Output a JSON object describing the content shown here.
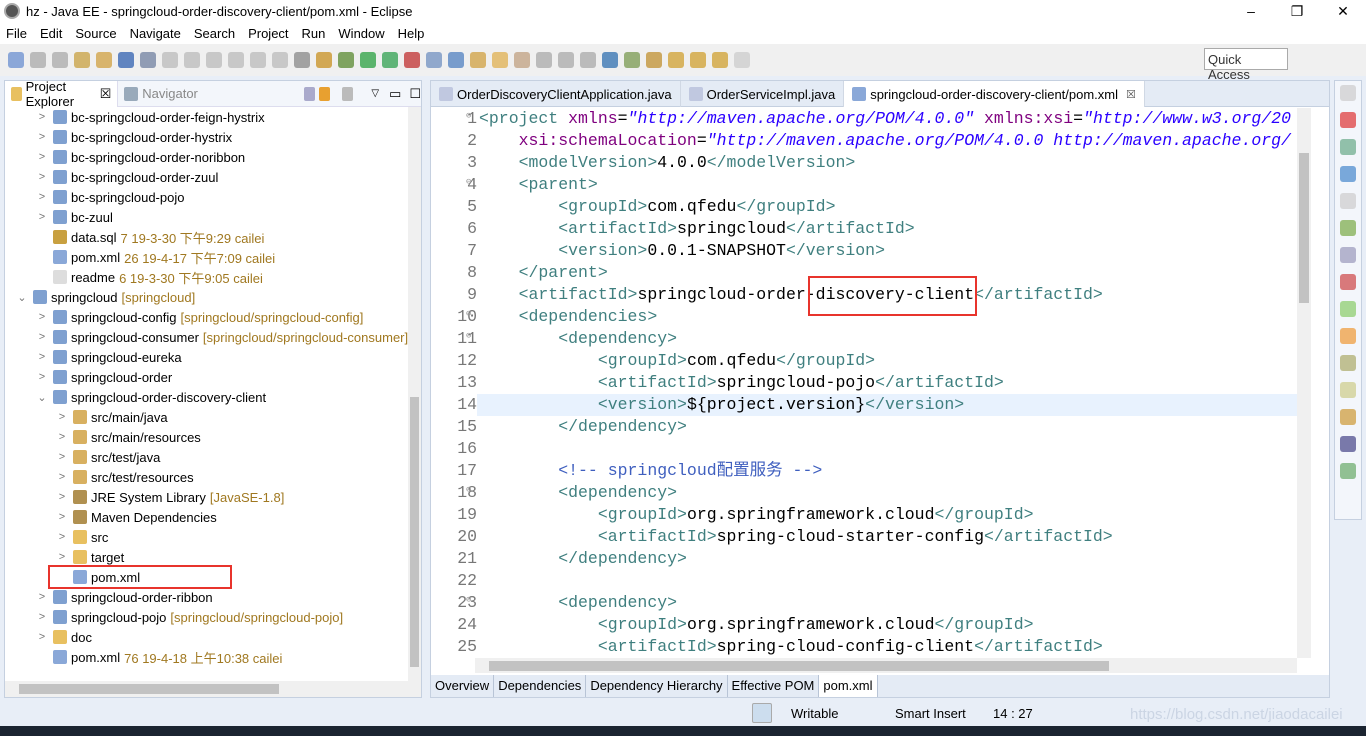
{
  "window": {
    "title": "hz - Java EE - springcloud-order-discovery-client/pom.xml - Eclipse",
    "controls": [
      "–",
      "❐",
      "✕"
    ]
  },
  "menu": [
    "File",
    "Edit",
    "Source",
    "Navigate",
    "Search",
    "Project",
    "Run",
    "Window",
    "Help"
  ],
  "quick_access": "Quick Access",
  "explorer": {
    "tabs": [
      {
        "label": "Project Explorer",
        "icon": "folder-icon",
        "close": "☒"
      },
      {
        "label": "Navigator",
        "icon": "navigator-icon"
      }
    ],
    "rows": [
      {
        "indent": 2,
        "tw": ">",
        "label": "bc-springcloud-order-feign-hystrix",
        "icon": "maven-project-icon"
      },
      {
        "indent": 2,
        "tw": ">",
        "label": "bc-springcloud-order-hystrix",
        "icon": "maven-project-icon"
      },
      {
        "indent": 2,
        "tw": ">",
        "label": "bc-springcloud-order-noribbon",
        "icon": "maven-project-icon"
      },
      {
        "indent": 2,
        "tw": ">",
        "label": "bc-springcloud-order-zuul",
        "icon": "maven-project-icon"
      },
      {
        "indent": 2,
        "tw": ">",
        "label": "bc-springcloud-pojo",
        "icon": "maven-project-icon"
      },
      {
        "indent": 2,
        "tw": ">",
        "label": "bc-zuul",
        "icon": "maven-project-icon"
      },
      {
        "indent": 2,
        "tw": "",
        "label": "data.sql",
        "dec": "7  19-3-30 下午9:29  cailei",
        "icon": "sql-file-icon"
      },
      {
        "indent": 2,
        "tw": "",
        "label": "pom.xml",
        "dec": "26  19-4-17 下午7:09  cailei",
        "icon": "xml-file-icon"
      },
      {
        "indent": 2,
        "tw": "",
        "label": "readme",
        "dec": "6  19-3-30 下午9:05  cailei",
        "icon": "text-file-icon"
      },
      {
        "indent": 1,
        "tw": "⌄",
        "label": "springcloud",
        "dec": "[springcloud]",
        "icon": "maven-project-icon"
      },
      {
        "indent": 2,
        "tw": ">",
        "label": "springcloud-config",
        "dec": "[springcloud/springcloud-config]",
        "icon": "maven-project-icon"
      },
      {
        "indent": 2,
        "tw": ">",
        "label": "springcloud-consumer",
        "dec": "[springcloud/springcloud-consumer]",
        "icon": "maven-project-icon"
      },
      {
        "indent": 2,
        "tw": ">",
        "label": "springcloud-eureka",
        "icon": "maven-project-icon"
      },
      {
        "indent": 2,
        "tw": ">",
        "label": "springcloud-order",
        "icon": "maven-project-icon"
      },
      {
        "indent": 2,
        "tw": "⌄",
        "label": "springcloud-order-discovery-client",
        "icon": "maven-project-icon"
      },
      {
        "indent": 3,
        "tw": ">",
        "label": "src/main/java",
        "icon": "package-folder-icon"
      },
      {
        "indent": 3,
        "tw": ">",
        "label": "src/main/resources",
        "icon": "package-folder-icon"
      },
      {
        "indent": 3,
        "tw": ">",
        "label": "src/test/java",
        "icon": "package-folder-icon"
      },
      {
        "indent": 3,
        "tw": ">",
        "label": "src/test/resources",
        "icon": "package-folder-icon"
      },
      {
        "indent": 3,
        "tw": ">",
        "label": "JRE System Library",
        "dec": "[JavaSE-1.8]",
        "icon": "library-icon"
      },
      {
        "indent": 3,
        "tw": ">",
        "label": "Maven Dependencies",
        "icon": "library-icon"
      },
      {
        "indent": 3,
        "tw": ">",
        "label": "src",
        "icon": "folder-icon"
      },
      {
        "indent": 3,
        "tw": ">",
        "label": "target",
        "icon": "folder-icon"
      },
      {
        "indent": 3,
        "tw": "",
        "label": "pom.xml",
        "icon": "xml-file-icon",
        "highlight": true
      },
      {
        "indent": 2,
        "tw": ">",
        "label": "springcloud-order-ribbon",
        "icon": "maven-project-icon"
      },
      {
        "indent": 2,
        "tw": ">",
        "label": "springcloud-pojo",
        "dec": "[springcloud/springcloud-pojo]",
        "icon": "maven-project-icon"
      },
      {
        "indent": 2,
        "tw": ">",
        "label": "doc",
        "icon": "folder-icon"
      },
      {
        "indent": 2,
        "tw": "",
        "label": "pom.xml",
        "dec": "76  19-4-18 上午10:38  cailei",
        "icon": "xml-file-icon"
      }
    ]
  },
  "editor": {
    "tabs": [
      {
        "label": "OrderDiscoveryClientApplication.java"
      },
      {
        "label": "OrderServiceImpl.java"
      },
      {
        "label": "springcloud-order-discovery-client/pom.xml",
        "active": true
      }
    ],
    "current_line": 14,
    "lines": [
      {
        "n": 1,
        "fold": true,
        "t": [
          [
            "tag",
            "<project "
          ],
          [
            "attr",
            "xmlns"
          ],
          [
            "txt",
            "="
          ],
          [
            "val",
            "\"http://maven.apache.org/POM/4.0.0\""
          ],
          [
            "txt",
            " "
          ],
          [
            "attr",
            "xmlns:xsi"
          ],
          [
            "txt",
            "="
          ],
          [
            "val",
            "\"http://www.w3.org/20"
          ]
        ]
      },
      {
        "n": 2,
        "t": [
          [
            "txt",
            "    "
          ],
          [
            "attr",
            "xsi:schemaLocation"
          ],
          [
            "txt",
            "="
          ],
          [
            "val",
            "\"http://maven.apache.org/POM/4.0.0 http://maven.apache.org/"
          ]
        ]
      },
      {
        "n": 3,
        "t": [
          [
            "tag",
            "    <modelVersion>"
          ],
          [
            "txt",
            "4.0.0"
          ],
          [
            "tag",
            "</modelVersion>"
          ]
        ]
      },
      {
        "n": 4,
        "fold": true,
        "t": [
          [
            "tag",
            "    <parent>"
          ]
        ]
      },
      {
        "n": 5,
        "t": [
          [
            "tag",
            "        <groupId>"
          ],
          [
            "txt",
            "com.qfedu"
          ],
          [
            "tag",
            "</groupId>"
          ]
        ]
      },
      {
        "n": 6,
        "t": [
          [
            "tag",
            "        <artifactId>"
          ],
          [
            "txt",
            "springcloud"
          ],
          [
            "tag",
            "</artifactId>"
          ]
        ]
      },
      {
        "n": 7,
        "t": [
          [
            "tag",
            "        <version>"
          ],
          [
            "txt",
            "0.0.1-SNAPSHOT"
          ],
          [
            "tag",
            "</version>"
          ]
        ]
      },
      {
        "n": 8,
        "t": [
          [
            "tag",
            "    </parent>"
          ]
        ]
      },
      {
        "n": 9,
        "t": [
          [
            "tag",
            "    <artifactId>"
          ],
          [
            "txt",
            "springcloud-order-discovery-client"
          ],
          [
            "tag",
            "</artifactId>"
          ]
        ]
      },
      {
        "n": 10,
        "fold": true,
        "t": [
          [
            "tag",
            "    <dependencies>"
          ]
        ]
      },
      {
        "n": 11,
        "fold": true,
        "t": [
          [
            "tag",
            "        <dependency>"
          ]
        ]
      },
      {
        "n": 12,
        "t": [
          [
            "tag",
            "            <groupId>"
          ],
          [
            "txt",
            "com.qfedu"
          ],
          [
            "tag",
            "</groupId>"
          ]
        ]
      },
      {
        "n": 13,
        "t": [
          [
            "tag",
            "            <artifactId>"
          ],
          [
            "txt",
            "springcloud-pojo"
          ],
          [
            "tag",
            "</artifactId>"
          ]
        ]
      },
      {
        "n": 14,
        "t": [
          [
            "tag",
            "            <version>"
          ],
          [
            "txt",
            "${project.version}"
          ],
          [
            "tag",
            "</version>"
          ]
        ]
      },
      {
        "n": 15,
        "t": [
          [
            "tag",
            "        </dependency>"
          ]
        ]
      },
      {
        "n": 16,
        "t": []
      },
      {
        "n": 17,
        "t": [
          [
            "com",
            "        <!-- springcloud配置服务 -->"
          ]
        ]
      },
      {
        "n": 18,
        "fold": true,
        "t": [
          [
            "tag",
            "        <dependency>"
          ]
        ]
      },
      {
        "n": 19,
        "t": [
          [
            "tag",
            "            <groupId>"
          ],
          [
            "txt",
            "org.springframework.cloud"
          ],
          [
            "tag",
            "</groupId>"
          ]
        ]
      },
      {
        "n": 20,
        "t": [
          [
            "tag",
            "            <artifactId>"
          ],
          [
            "txt",
            "spring-cloud-starter-config"
          ],
          [
            "tag",
            "</artifactId>"
          ]
        ]
      },
      {
        "n": 21,
        "t": [
          [
            "tag",
            "        </dependency>"
          ]
        ]
      },
      {
        "n": 22,
        "t": []
      },
      {
        "n": 23,
        "fold": true,
        "t": [
          [
            "tag",
            "        <dependency>"
          ]
        ]
      },
      {
        "n": 24,
        "t": [
          [
            "tag",
            "            <groupId>"
          ],
          [
            "txt",
            "org.springframework.cloud"
          ],
          [
            "tag",
            "</groupId>"
          ]
        ]
      },
      {
        "n": 25,
        "t": [
          [
            "tag",
            "            <artifactId>"
          ],
          [
            "txt",
            "spring-cloud-config-client"
          ],
          [
            "tag",
            "</artifactId>"
          ]
        ]
      }
    ],
    "bottom_tabs": [
      "Overview",
      "Dependencies",
      "Dependency Hierarchy",
      "Effective POM",
      "pom.xml"
    ]
  },
  "status": {
    "writable": "Writable",
    "insert_mode": "Smart Insert",
    "position": "14 : 27",
    "watermark": "https://blog.csdn.net/jiaodacailei"
  },
  "colors": {
    "highlight_box": "#e8342c",
    "tag": "#3f7f7f",
    "attr": "#7f007f",
    "value": "#2a00ff",
    "comment": "#3f5fbf"
  }
}
